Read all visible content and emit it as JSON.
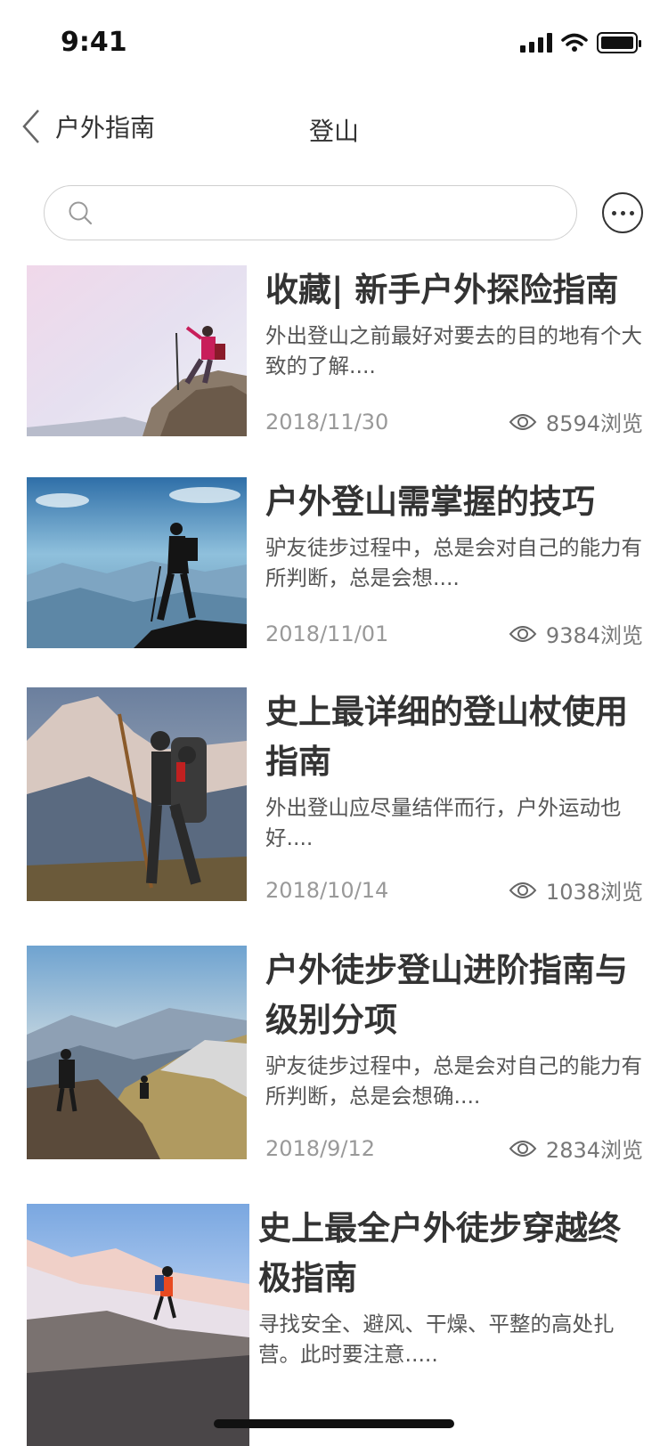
{
  "status_bar": {
    "time": "9:41"
  },
  "nav": {
    "back_label": "户外指南",
    "title": "登山"
  },
  "search": {
    "placeholder": "",
    "value": ""
  },
  "articles": [
    {
      "title": "收藏| 新手户外探险指南",
      "desc": "外出登山之前最好对要去的目的地有个大致的了解....",
      "date": "2018/11/30",
      "views": "8594浏览"
    },
    {
      "title": "户外登山需掌握的技巧",
      "desc": "驴友徒步过程中，总是会对自己的能力有所判断，总是会想....",
      "date": "2018/11/01",
      "views": "9384浏览"
    },
    {
      "title": "史上最详细的登山杖使用指南",
      "desc": "外出登山应尽量结伴而行，户外运动也好....",
      "date": "2018/10/14",
      "views": "1038浏览"
    },
    {
      "title": "户外徒步登山进阶指南与级别分项",
      "desc": "驴友徒步过程中，总是会对自己的能力有所判断，总是会想确....",
      "date": "2018/9/12",
      "views": "2834浏览"
    },
    {
      "title": "史上最全户外徒步穿越终极指南",
      "desc": "寻找安全、避风、干燥、平整的高处扎营。此时要注意.....",
      "date": "",
      "views": ""
    }
  ],
  "icons": {
    "back": "chevron-left-icon",
    "search": "search-icon",
    "more": "more-icon",
    "views": "eye-icon"
  }
}
